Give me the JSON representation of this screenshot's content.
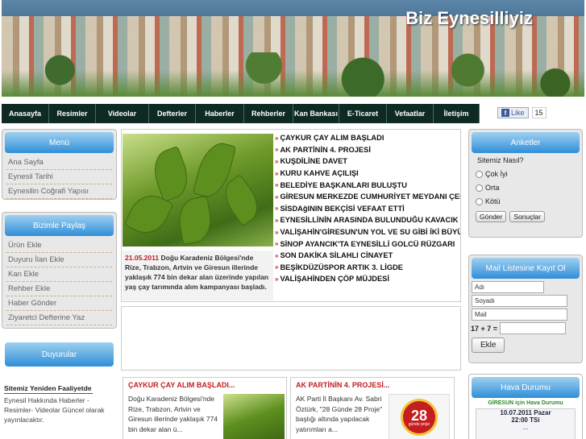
{
  "banner": {
    "title": "Biz Eynesilliyiz"
  },
  "nav": [
    {
      "label": "Anasayfa",
      "w": 59
    },
    {
      "label": "Resimler",
      "w": 58
    },
    {
      "label": "Videolar",
      "w": 66
    },
    {
      "label": "Defterler",
      "w": 58
    },
    {
      "label": "Haberler",
      "w": 60
    },
    {
      "label": "Rehberler",
      "w": 61
    },
    {
      "label": "Kan Bankası",
      "w": 57
    },
    {
      "label": "E-Ticaret",
      "w": 59
    },
    {
      "label": "Vefaatlar",
      "w": 58
    },
    {
      "label": "İletişim",
      "w": 57
    }
  ],
  "facebook": {
    "like_label": "Like",
    "count": "15"
  },
  "left": {
    "menu": {
      "title": "Menü",
      "items": [
        "Ana Sayfa",
        "Eynesil Tarihi",
        "Eynesilin Coğrafi Yapısı"
      ]
    },
    "share": {
      "title": "Bizimle Paylaş",
      "items": [
        "Ürün Ekle",
        "Duyuru İlan Ekle",
        "Kan Ekle",
        "Rehber Ekle",
        "Haber Gönder",
        "Ziyaretci Defterine Yaz"
      ]
    },
    "announcements": {
      "title": "Duyurular",
      "heading": "Sitemiz Yeniden Faaliyetde",
      "text": "Eynesil Hakkında Haberler - Resimler- Videolar Güncel olarak yayınlacaktır."
    }
  },
  "featured": {
    "date": "21.05.2011",
    "caption": "Doğu Karadeniz Bölgesi'nde Rize, Trabzon, Artvin ve Giresun illerinde yaklaşık 774 bin dekar alan üzerinde yapılan yaş çay tarımında alım kampanyası başladı."
  },
  "headlines": [
    "ÇAYKUR ÇAY ALIM BAŞLADI",
    "AK PARTİNİN 4. PROJESİ",
    "KUŞDİLİNE DAVET",
    "KURU KAHVE AÇILIŞI",
    "BELEDİYE BAŞKANLARI BULUŞTU",
    "GİRESUN MERKEZDE CUMHURİYET MEYDANI ÇEI",
    "SİSDAğININ BEKÇİSİ VEFAAT ETTİ",
    "EYNESİLLİNİN ARASINDA BULUNDUĞU KAVACIK",
    "VALİŞAHİN'GİRESUN'UN YOL VE SU GİBİ İKİ BÜYÜ",
    "SİNOP AYANCIK'TA EYNESİLLİ GOLCÜ RÜZGARI",
    "SON DAKİKA SİLAHLI CİNAYET",
    "BEŞİKDÜZÜSPOR ARTIK 3. LİGDE",
    "VALİŞAHİNDEN ÇÖP MÜJDESİ"
  ],
  "cards": [
    {
      "title": "ÇAYKUR ÇAY ALIM BAŞLADI...",
      "text": "Doğu Karadeniz Bölgesi'nde Rize, Trabzon, Artvin ve Giresun illerinde yaklaşık 774 bin dekar alan ü..."
    },
    {
      "title": "AK PARTİNİN 4. PROJESİ...",
      "text": "AK Parti İl Başkanı Av. Sabri Öztürk, \"28 Günde 28 Proje\" başlığı altında yapılacak yatırımları a...",
      "badge": "28",
      "badge_sub": "günde proje"
    }
  ],
  "right": {
    "poll": {
      "title": "Anketler",
      "question": "Sitemiz Nasıl?",
      "options": [
        "Çok İyi",
        "Orta",
        "Kötü"
      ],
      "vote_button": "Gönder",
      "results_button": "Sonuçlar"
    },
    "mail": {
      "title": "Mail Listesine Kayıt Ol",
      "fields": [
        "Adı",
        "Soyadı",
        "Mail"
      ],
      "captcha": "17 + 7 =",
      "submit": "Ekle"
    },
    "weather": {
      "title": "Hava Durumu",
      "location": "GİRESUN için Hava Durumu",
      "date": "10.07.2011 Pazar",
      "time": "22:00 TSi",
      "value": "..."
    }
  }
}
